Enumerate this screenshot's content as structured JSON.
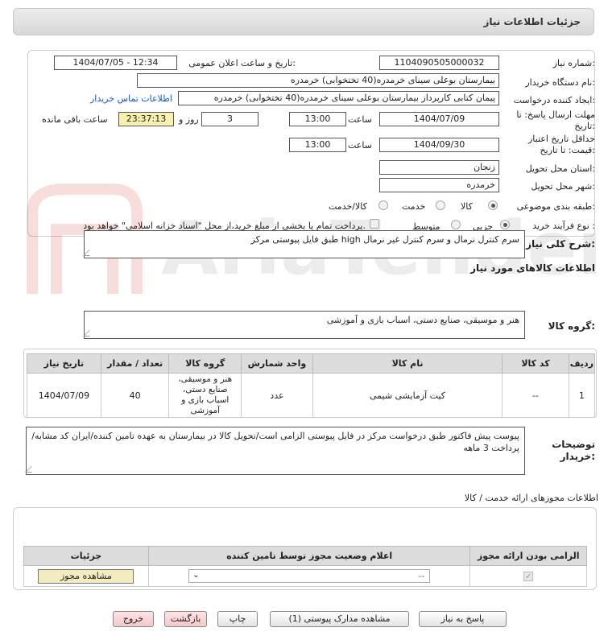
{
  "header": {
    "title": "جزئیات اطلاعات نیاز"
  },
  "form": {
    "need_number_label": "شماره نیاز:",
    "need_number": "1104090505000032",
    "announce_label": "تاریخ و ساعت اعلان عمومی:",
    "announce_value": "1404/07/05 - 12:34",
    "buyer_org_label": "نام دستگاه خریدار:",
    "buyer_org": "بیمارستان بوعلی سینای خرمدره(40 تختخوابی) خرمدره",
    "creator_label": "ایجاد کننده درخواست:",
    "creator": "پیمان کتابی کارپرداز بیمارستان بوعلی سینای خرمدره(40 تختخوابی) خرمدره",
    "contact_link": "اطلاعات تماس خریدار",
    "reply_deadline_label": "مهلت ارسال پاسخ: تا تاریخ:",
    "reply_date": "1404/07/09",
    "time_label": "ساعت",
    "reply_time": "13:00",
    "days": "3",
    "days_label": "روز و",
    "remaining": "23:37:13",
    "remaining_label": "ساعت باقی مانده",
    "min_price_label": "حداقل تاریخ اعتبار قیمت: تا تاریخ:",
    "price_date": "1404/09/30",
    "price_time": "13:00",
    "province_label": "استان محل تحویل:",
    "province": "زنجان",
    "city_label": "شهر محل تحویل:",
    "city": "خرمدره",
    "category_label": "طبقه بندی موضوعی:",
    "cat_goods": "کالا",
    "cat_service": "خدمت",
    "cat_both": "کالا/خدمت",
    "process_label": "نوع فرآیند خرید :",
    "proc_partial": "جزیی",
    "proc_medium": "متوسط",
    "payment_note": "پرداخت تمام یا بخشی از مبلغ خرید،از محل \"اسناد خزانه اسلامی\" خواهد بود."
  },
  "summary": {
    "label": "شرح کلی نیاز:",
    "text": "سرم کنترل نرمال و سرم کنترل غیر نرمال high طبق فایل پیوستی مرکز"
  },
  "goods": {
    "section_title": "اطلاعات کالاهای مورد نیاز",
    "group_label": "گروه کالا:",
    "group_text": "هنر و موسیقی، صنایع دستی، اسباب بازی و آموزشی",
    "columns": [
      "ردیف",
      "کد کالا",
      "نام کالا",
      "واحد شمارش",
      "گروه کالا",
      "تعداد / مقدار",
      "تاریخ نیاز"
    ],
    "rows": [
      [
        "1",
        "--",
        "کیت آزمایشی شیمی",
        "عدد",
        "هنر و موسیقی، صنایع دستی، اسباب بازی و آموزشی",
        "40",
        "1404/07/09"
      ]
    ]
  },
  "buyer_notes": {
    "label": "توضیحات خریدار:",
    "text": "پیوست پیش فاکتور طبق درخواست مرکز در فایل پیوستی الزامی است/تحویل کالا در بیمارستان به عهده تامین کننده/ایران کد مشابه/پرداخت 3 ماهه"
  },
  "permits": {
    "title": "اطلاعات مجوزهای ارائه خدمت / کالا",
    "columns": [
      "الزامی بودن ارائه مجوز",
      "اعلام وضعیت مجوز توسط تامین کننده",
      "جزئیات"
    ],
    "select_value": "--",
    "view_button": "مشاهده مجوز"
  },
  "buttons": {
    "reply": "پاسخ به نیاز",
    "attachments": "مشاهده مدارک پیوستی (1)",
    "print": "چاپ",
    "back": "بازگشت",
    "exit": "خروج"
  },
  "watermark": "AriaTender.neT"
}
